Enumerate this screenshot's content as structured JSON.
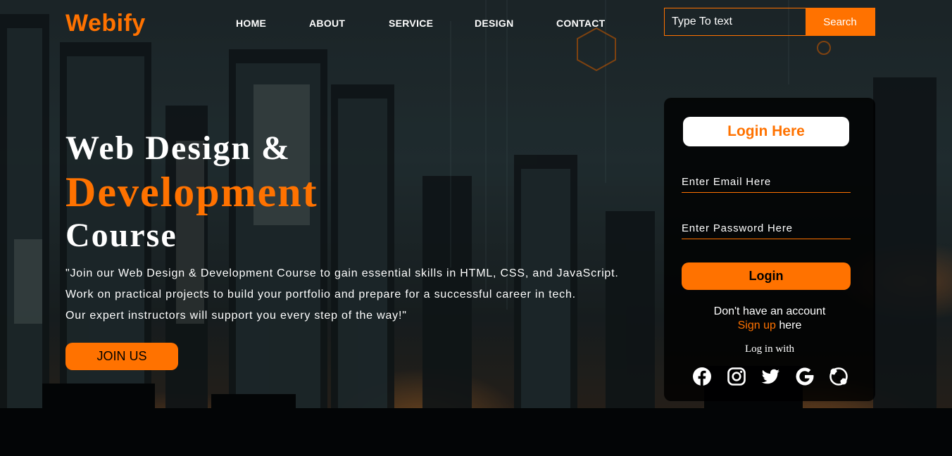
{
  "brand": {
    "name": "Webify",
    "accent": "#ff7200"
  },
  "nav": {
    "items": [
      {
        "label": "HOME"
      },
      {
        "label": "ABOUT"
      },
      {
        "label": "SERVICE"
      },
      {
        "label": "DESIGN"
      },
      {
        "label": "CONTACT"
      }
    ]
  },
  "search": {
    "placeholder": "Type To text",
    "button_label": "Search"
  },
  "hero": {
    "line1": "Web Design &",
    "line2": "Development",
    "line3": "Course",
    "description": [
      "\"Join our Web Design & Development Course to gain essential skills in HTML, CSS, and JavaScript.",
      "Work on practical projects to build your portfolio and prepare for a successful career in tech.",
      "Our expert instructors will support you every step of the way!\""
    ],
    "join_label": "JOIN US"
  },
  "login": {
    "title": "Login Here",
    "email_placeholder": "Enter Email Here",
    "password_placeholder": "Enter Password Here",
    "button_label": "Login",
    "no_account": "Don't have an account",
    "signup_link": "Sign up",
    "signup_suffix": " here",
    "log_with": "Log in with",
    "socials": [
      {
        "icon": "facebook-icon"
      },
      {
        "icon": "instagram-icon"
      },
      {
        "icon": "twitter-icon"
      },
      {
        "icon": "google-icon"
      },
      {
        "icon": "skype-icon"
      }
    ]
  }
}
